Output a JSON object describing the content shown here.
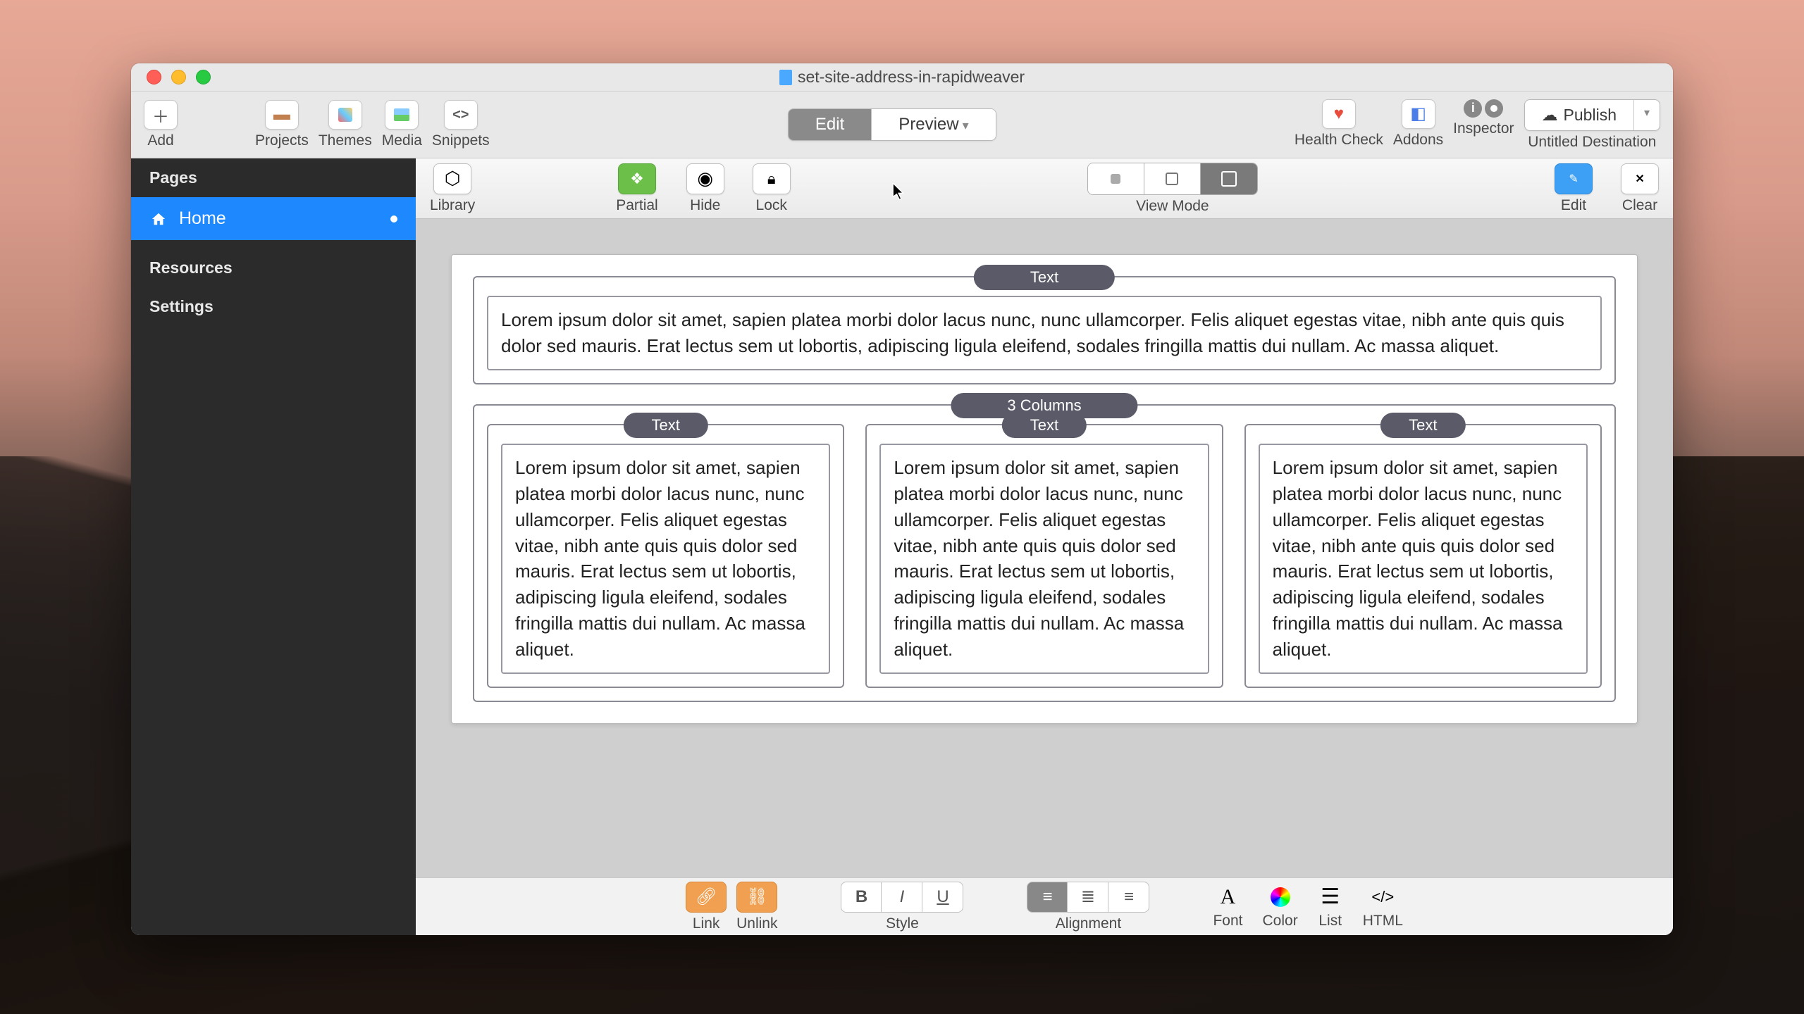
{
  "window": {
    "title": "set-site-address-in-rapidweaver"
  },
  "toolbar": {
    "add": "Add",
    "projects": "Projects",
    "themes": "Themes",
    "media": "Media",
    "snippets": "Snippets",
    "edit": "Edit",
    "preview": "Preview",
    "health_check": "Health Check",
    "addons": "Addons",
    "inspector": "Inspector",
    "publish": "Publish",
    "destination": "Untitled Destination"
  },
  "sidebar": {
    "pages": "Pages",
    "home": "Home",
    "resources": "Resources",
    "settings": "Settings"
  },
  "stackbar": {
    "library": "Library",
    "partial": "Partial",
    "hide": "Hide",
    "lock": "Lock",
    "view_mode": "View Mode",
    "edit": "Edit",
    "clear": "Clear"
  },
  "canvas": {
    "text_label": "Text",
    "cols3_label": "3 Columns",
    "lorem": "Lorem ipsum dolor sit amet, sapien platea morbi dolor lacus nunc, nunc ullamcorper. Felis aliquet egestas vitae, nibh ante quis quis dolor sed mauris. Erat lectus sem ut lobortis, adipiscing ligula eleifend, sodales fringilla mattis dui nullam. Ac massa aliquet."
  },
  "bottombar": {
    "link": "Link",
    "unlink": "Unlink",
    "style": "Style",
    "alignment": "Alignment",
    "font": "Font",
    "color": "Color",
    "list": "List",
    "html": "HTML"
  }
}
